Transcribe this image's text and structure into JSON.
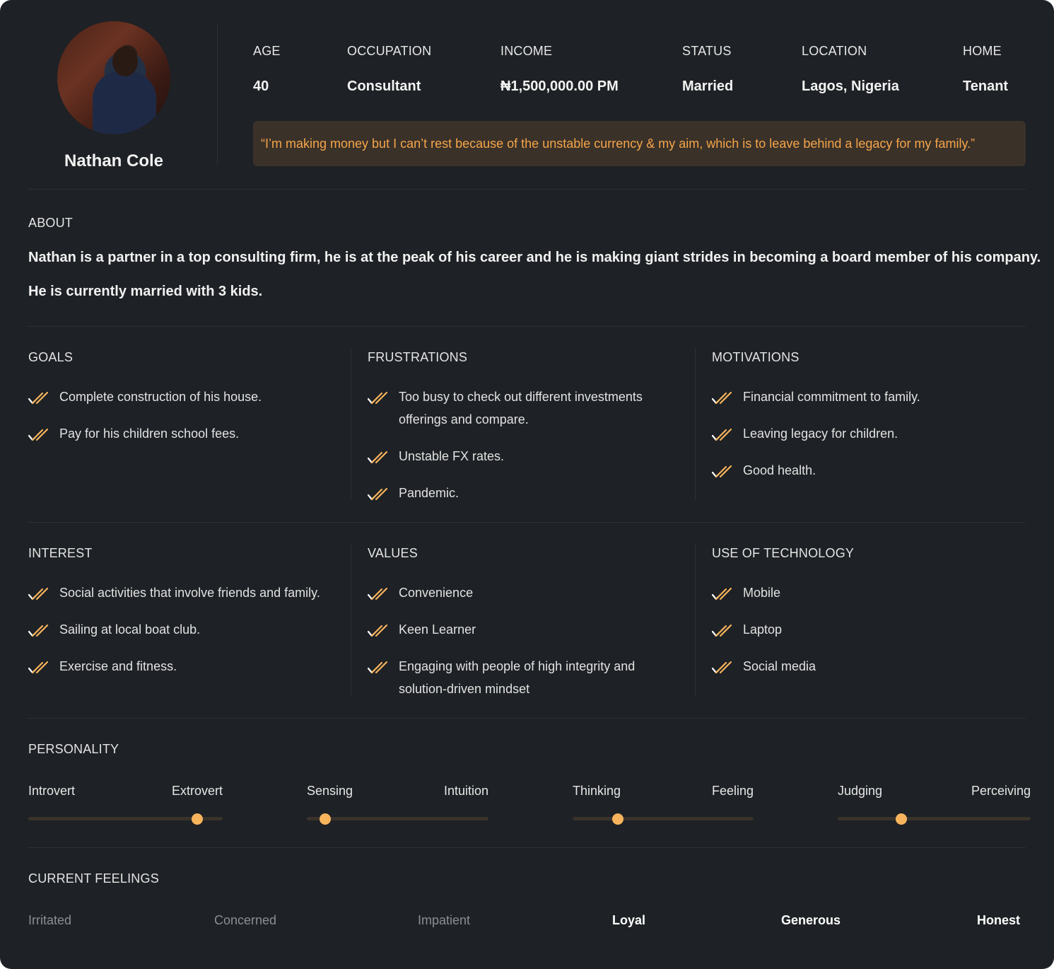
{
  "profile": {
    "name": "Nathan Cole"
  },
  "stats": [
    {
      "label": "AGE",
      "value": "40"
    },
    {
      "label": "OCCUPATION",
      "value": "Consultant"
    },
    {
      "label": "INCOME",
      "value": "₦1,500,000.00 PM"
    },
    {
      "label": "STATUS",
      "value": "Married"
    },
    {
      "label": "LOCATION",
      "value": "Lagos, Nigeria"
    },
    {
      "label": "HOME",
      "value": "Tenant"
    }
  ],
  "quote": "“I’m making money but I can’t rest because of the unstable currency & my aim, which is to leave behind a legacy for my family.”",
  "about": {
    "title": "ABOUT",
    "line1": "Nathan is a partner in a top consulting firm, he is at the peak of his career and he is making giant strides in becoming a board member of his company.",
    "line2": "He is currently married with 3 kids."
  },
  "goals": {
    "title": "GOALS",
    "items": [
      "Complete construction of his house.",
      "Pay for his children school fees."
    ]
  },
  "frustrations": {
    "title": "FRUSTRATIONS",
    "items": [
      "Too busy to check out different investments offerings and compare.",
      "Unstable FX rates.",
      "Pandemic."
    ]
  },
  "motivations": {
    "title": "MOTIVATIONS",
    "items": [
      "Financial commitment to family.",
      "Leaving legacy for children.",
      "Good health."
    ]
  },
  "interest": {
    "title": "INTEREST",
    "items": [
      "Social activities that involve friends and family.",
      "Sailing at local boat club.",
      "Exercise and fitness."
    ]
  },
  "values": {
    "title": "VALUES",
    "items": [
      "Convenience",
      "Keen Learner",
      "Engaging with people of high integrity and solution-driven mindset"
    ]
  },
  "technology": {
    "title": "USE OF TECHNOLOGY",
    "items": [
      "Mobile",
      "Laptop",
      "Social media"
    ]
  },
  "personality": {
    "title": "PERSONALITY",
    "traits": [
      {
        "left": "Introvert",
        "right": "Extrovert",
        "value": 0.87
      },
      {
        "left": "Sensing",
        "right": "Intuition",
        "value": 0.1
      },
      {
        "left": "Thinking",
        "right": "Feeling",
        "value": 0.25
      },
      {
        "left": "Judging",
        "right": "Perceiving",
        "value": 0.33
      }
    ]
  },
  "feelings": {
    "title": "CURRENT FEELINGS",
    "items": [
      {
        "label": "Irritated",
        "active": false
      },
      {
        "label": "Concerned",
        "active": false
      },
      {
        "label": "Impatient",
        "active": false
      },
      {
        "label": "Loyal",
        "active": true
      },
      {
        "label": "Generous",
        "active": true
      },
      {
        "label": "Honest",
        "active": true
      }
    ]
  },
  "colors": {
    "background": "#1e2125",
    "accent": "#f8b45c",
    "quote_bg": "#3a3129",
    "quote_text": "#f5a54a"
  }
}
